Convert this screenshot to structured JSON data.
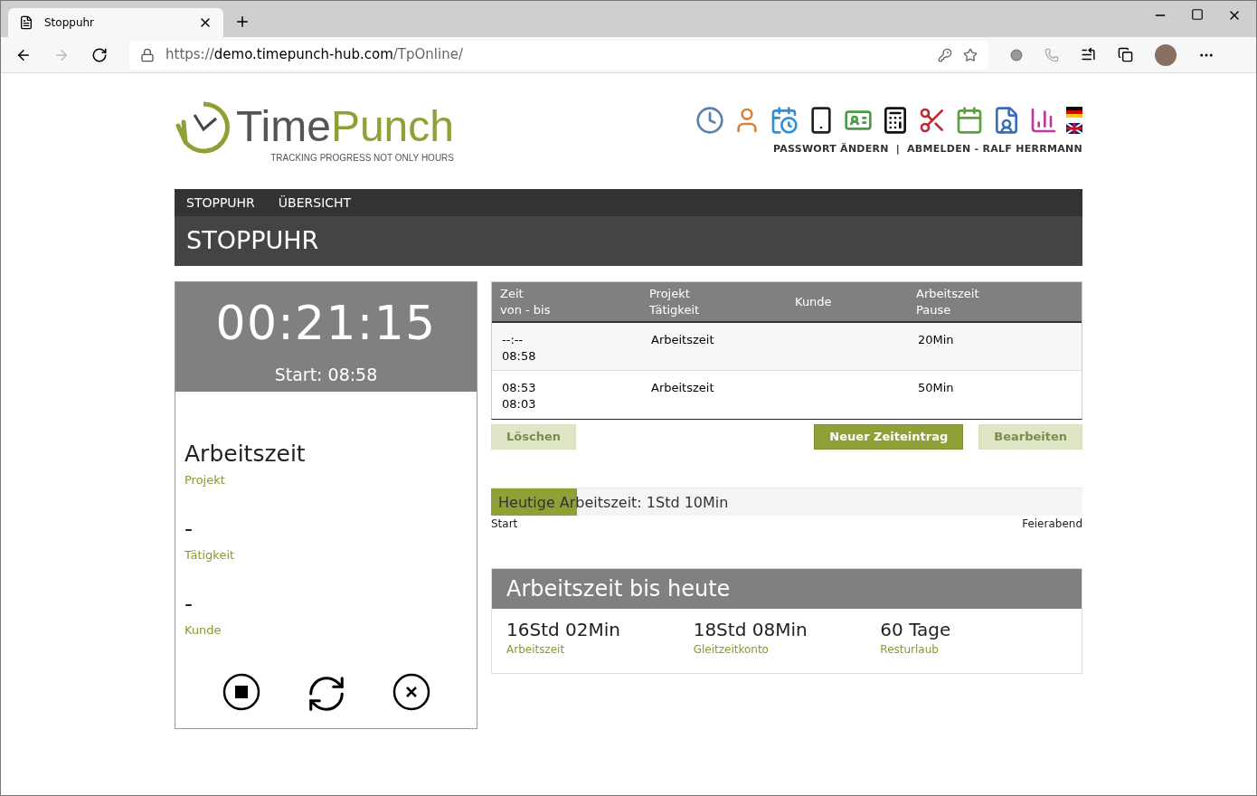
{
  "browser": {
    "tab_title": "Stoppuhr",
    "url_host": "demo.timepunch-hub.com",
    "url_prefix": "https://",
    "url_path": "/TpOnline/"
  },
  "header": {
    "logo_part_1": "Time",
    "logo_part_2": "Punch",
    "tagline": "TRACKING PROGRESS NOT ONLY HOURS",
    "links": [
      "PASSWORT ÄNDERN",
      "|",
      "ABMELDEN - RALF HERRMANN"
    ]
  },
  "nav": {
    "items": [
      "STOPPUHR",
      "ÜBERSICHT"
    ],
    "page_title": "STOPPUHR"
  },
  "timer": {
    "elapsed": "00:21:15",
    "start": "Start: 08:58",
    "fields": [
      {
        "value": "Arbeitszeit",
        "label": "Projekt"
      },
      {
        "value": "-",
        "label": "Tätigkeit"
      },
      {
        "value": "-",
        "label": "Kunde"
      }
    ]
  },
  "table": {
    "columns": [
      [
        "Zeit",
        "von - bis"
      ],
      [
        "Projekt",
        "Tätigkeit"
      ],
      [
        "Kunde"
      ],
      [
        "Arbeitszeit",
        "Pause"
      ]
    ],
    "rows": [
      {
        "times": [
          "--:--",
          "08:58"
        ],
        "project": "Arbeitszeit",
        "duration": "20Min"
      },
      {
        "times": [
          "08:53",
          "08:03"
        ],
        "project": "Arbeitszeit",
        "duration": "50Min"
      }
    ]
  },
  "buttons": [
    {
      "label": "Löschen",
      "disabled": true
    },
    {
      "label": "Neuer Zeiteintrag",
      "disabled": false
    },
    {
      "label": "Bearbeiten",
      "disabled": true
    }
  ],
  "today": {
    "label": "Heutige Arbeitszeit: 1Std 10Min",
    "level": 0.146,
    "start_label": "Start",
    "end_label": "Feierabend"
  },
  "summary": {
    "title": "Arbeitszeit bis heute",
    "stats": [
      {
        "value": "16Std 02Min",
        "label": "Arbeitszeit"
      },
      {
        "value": "18Std 08Min",
        "label": "Gleitzeitkonto"
      },
      {
        "value": "60 Tage",
        "label": "Resturlaub"
      }
    ]
  }
}
